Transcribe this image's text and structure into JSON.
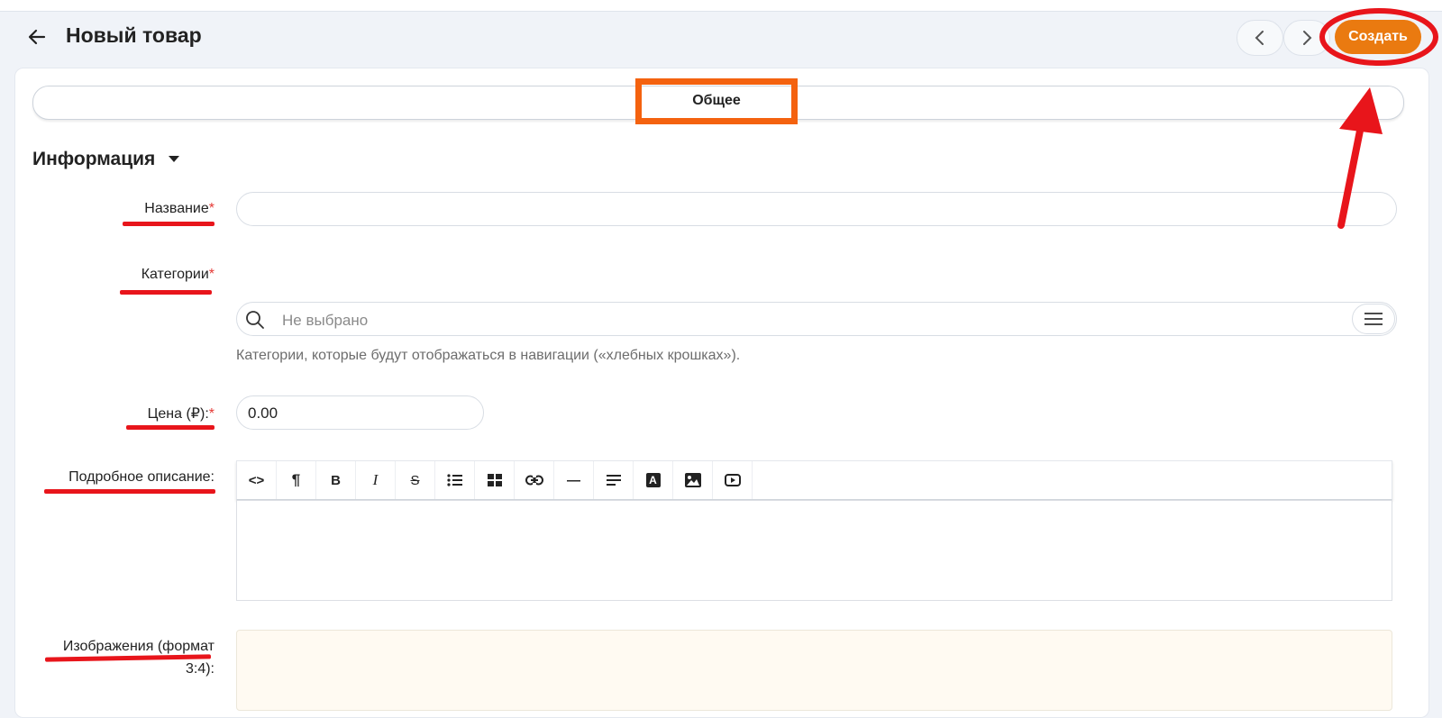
{
  "header": {
    "title": "Новый товар",
    "create_label": "Создать"
  },
  "tabs": [
    {
      "label": "Общее"
    }
  ],
  "section": {
    "title": "Информация"
  },
  "fields": {
    "name": {
      "label": "Название",
      "required_mark": "*",
      "value": ""
    },
    "categories": {
      "label": "Категории",
      "required_mark": "*",
      "placeholder": "Не выбрано",
      "hint": "Категории, которые будут отображаться в навигации («хлебных крошках»)."
    },
    "price": {
      "label": "Цена (₽):",
      "required_mark": "*",
      "value": "0.00"
    },
    "description": {
      "label": "Подробное описание:"
    },
    "images": {
      "label_line1": "Изображения (формат",
      "label_line2": "3:4):"
    }
  },
  "editor_toolbar": [
    {
      "icon": "code-icon",
      "glyph": "<>"
    },
    {
      "icon": "paragraph-icon",
      "glyph": "¶"
    },
    {
      "icon": "bold-icon",
      "glyph": "B"
    },
    {
      "icon": "italic-icon",
      "glyph": "I"
    },
    {
      "icon": "strikethrough-icon",
      "glyph": "S"
    },
    {
      "icon": "bullet-list-icon",
      "glyph": ""
    },
    {
      "icon": "table-icon",
      "glyph": ""
    },
    {
      "icon": "link-icon",
      "glyph": ""
    },
    {
      "icon": "horizontal-rule-icon",
      "glyph": "—"
    },
    {
      "icon": "align-icon",
      "glyph": ""
    },
    {
      "icon": "text-color-icon",
      "glyph": "A"
    },
    {
      "icon": "image-icon",
      "glyph": ""
    },
    {
      "icon": "video-icon",
      "glyph": ""
    }
  ],
  "colors": {
    "accent": "#ea7a10",
    "required": "#e53935",
    "annotation_red": "#e8151b",
    "annotation_orange": "#f4620f"
  }
}
